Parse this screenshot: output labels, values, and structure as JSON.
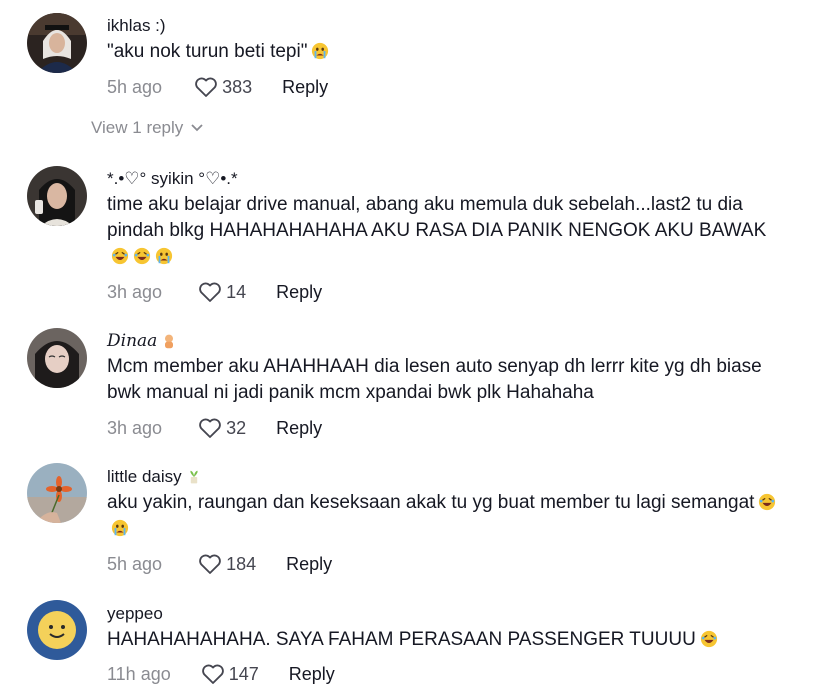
{
  "comments": [
    {
      "username": "ikhlas :)",
      "text": "\"aku nok turun beti tepi\"",
      "emojis": [
        "crying-face"
      ],
      "time": "5h ago",
      "likes": "383",
      "reply": "Reply",
      "view_replies": "View 1 reply"
    },
    {
      "username": "*.•♡° syikin °♡•.*",
      "text": "time aku belajar drive manual, abang aku memula duk sebelah...last2 tu dia pindah blkg HAHAHAHAHAHA AKU RASA DIA PANIK NENGOK AKU BAWAK",
      "emojis": [
        "laughing-face",
        "laughing-face",
        "crying-face"
      ],
      "time": "3h ago",
      "likes": "14",
      "reply": "Reply"
    },
    {
      "username": "Dinaa",
      "text": "Mcm member aku AHAHHAAH dia lesen auto senyap dh lerrr kite yg dh biase bwk manual ni jadi panik mcm xpandai bwk plk Hahahaha",
      "emojis": [],
      "time": "3h ago",
      "likes": "32",
      "reply": "Reply"
    },
    {
      "username": "little daisy",
      "text": "aku yakin, raungan dan keseksaan akak tu yg buat member tu lagi semangat",
      "emojis": [
        "laughing-face",
        "crying-face"
      ],
      "time": "5h ago",
      "likes": "184",
      "reply": "Reply"
    },
    {
      "username": "yeppeo",
      "text": "HAHAHAHAHAHA. SAYA FAHAM PERASAAN PASSENGER TUUUU",
      "emojis": [
        "laughing-face"
      ],
      "time": "11h ago",
      "likes": "147",
      "reply": "Reply"
    }
  ],
  "colors": {
    "text": "#161823",
    "muted": "#8a8b91",
    "count": "#454650"
  }
}
